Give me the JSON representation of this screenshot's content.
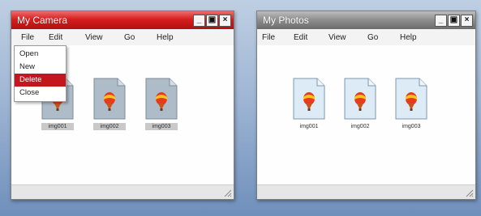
{
  "camera_window": {
    "title": "My Camera",
    "menu": [
      "File",
      "Edit",
      "View",
      "Go",
      "Help"
    ],
    "file_menu_items": [
      "Open",
      "New",
      "Delete",
      "Close"
    ],
    "highlighted_item": "Delete",
    "files": [
      "img001",
      "img002",
      "img003"
    ]
  },
  "photos_window": {
    "title": "My Photos",
    "menu": [
      "File",
      "Edit",
      "View",
      "Go",
      "Help"
    ],
    "files": [
      "img001",
      "img002",
      "img003"
    ]
  },
  "window_buttons": {
    "minimize": "_",
    "maximize": "▣",
    "close": "×"
  },
  "colors": {
    "active_titlebar": "#d61f1f",
    "inactive_titlebar": "#8c8c8c",
    "menu_highlight": "#c4161c"
  },
  "icons": {
    "file": "image-file-icon",
    "picture": "hot-air-balloon-icon"
  }
}
